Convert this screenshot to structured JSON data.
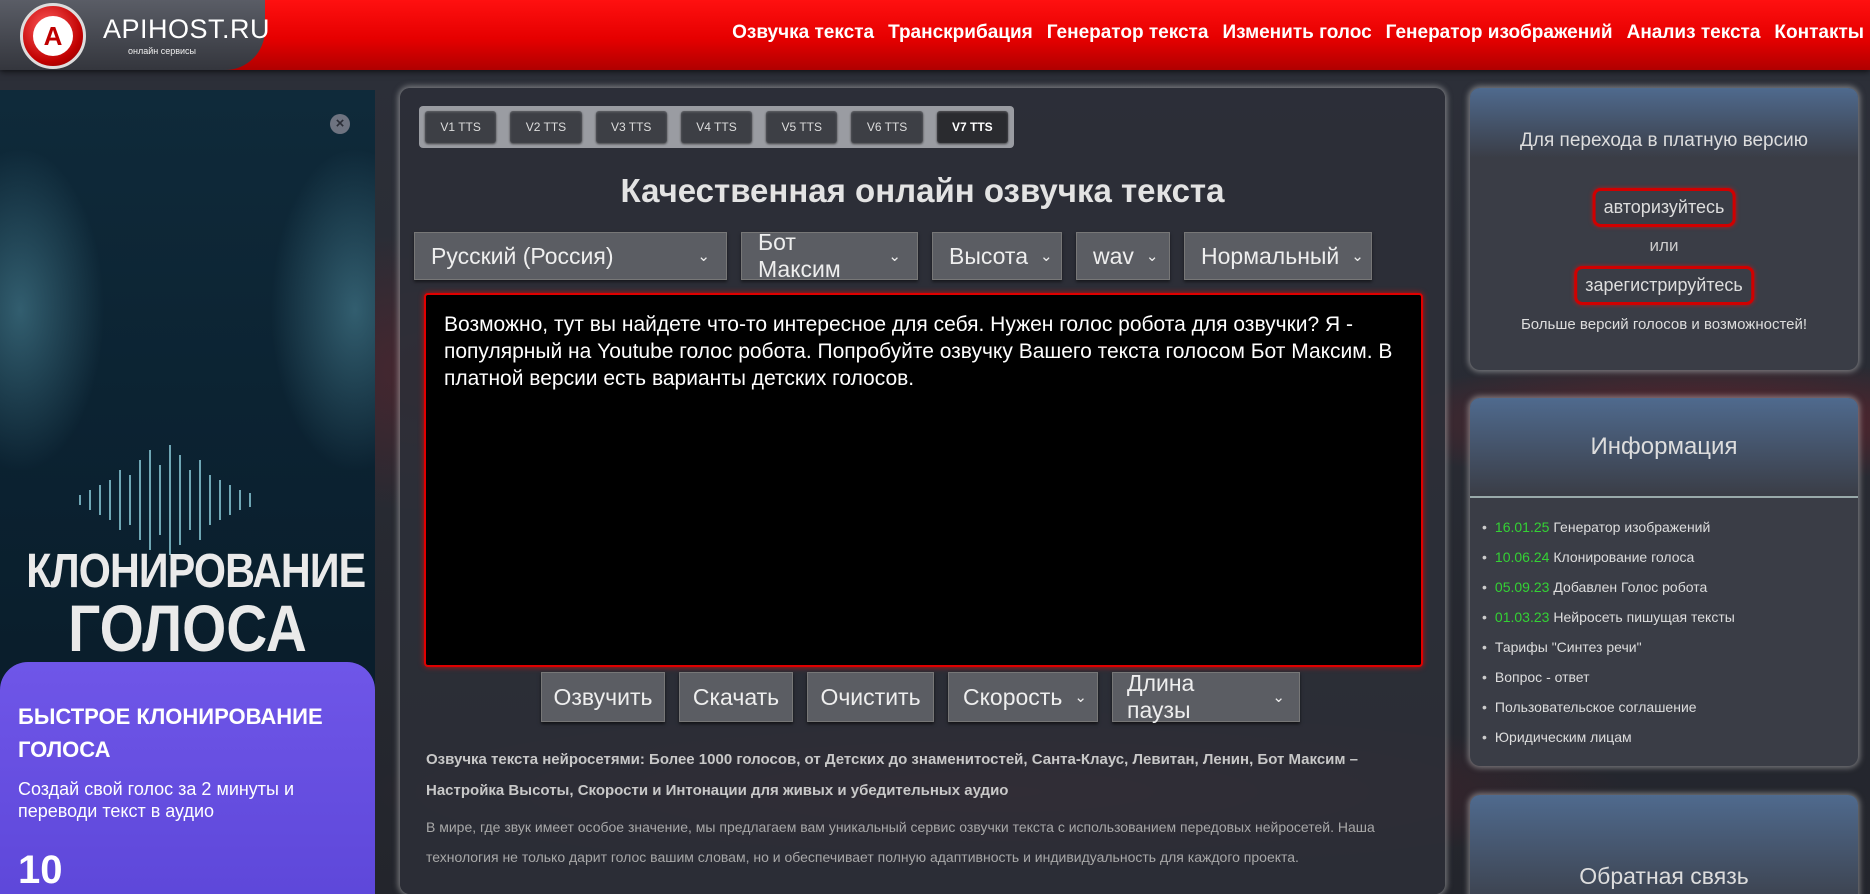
{
  "header": {
    "logo_text": "APIHOST.RU",
    "logo_sub": "онлайн сервисы",
    "nav": [
      "Озвучка текста",
      "Транскрибация",
      "Генератор текста",
      "Изменить голос",
      "Генератор изображений",
      "Анализ текста",
      "Контакты"
    ]
  },
  "ad": {
    "title_line1": "КЛОНИРОВАНИЕ",
    "title_line2": "ГОЛОСА",
    "card_title": "БЫСТРОЕ КЛОНИРОВАНИЕ ГОЛОСА",
    "card_text": "Создай свой голос за 2 минуты и переводи текст в аудио",
    "card_number": "10"
  },
  "tabs": [
    "V1 TTS",
    "V2 TTS",
    "V3 TTS",
    "V4 TTS",
    "V5 TTS",
    "V6 TTS",
    "V7 TTS"
  ],
  "active_tab": "V7 TTS",
  "main": {
    "title": "Качественная онлайн озвучка текста",
    "selects": {
      "language": "Русский (Россия)",
      "voice": "Бот Максим",
      "pitch": "Высота",
      "format": "wav",
      "mode": "Нормальный"
    },
    "text": "Возможно, тут вы найдете что-то интересное для себя. Нужен голос робота для озвучки? Я - популярный на Youtube голос робота. Попробуйте озвучку Вашего текста голосом Бот Максим. В платной версии есть варианты детских голосов.",
    "actions": {
      "speak": "Озвучить",
      "download": "Скачать",
      "clear": "Очистить",
      "speed": "Скорость",
      "pause": "Длина паузы"
    },
    "desc_bold": "Озвучка текста нейросетями: Более 1000 голосов, от Детских до знаменитостей, Санта-Клаус, Левитан, Ленин, Бот Максим – Настройка Высоты, Скорости и Интонации для живых и убедительных аудио",
    "desc": "В мире, где звук имеет особое значение, мы предлагаем вам уникальный сервис озвучки текста с использованием передовых нейросетей. Наша технология не только дарит голос вашим словам, но и обеспечивает полную адаптивность и индивидуальность для каждого проекта."
  },
  "paid": {
    "title": "Для перехода в платную версию",
    "login": "авторизуйтесь",
    "or": "или",
    "register": "зарегистрируйтесь",
    "more": "Больше версий голосов и возможностей!"
  },
  "info": {
    "title": "Информация",
    "items": [
      {
        "date": "16.01.25",
        "text": "Генератор изображений"
      },
      {
        "date": "10.06.24",
        "text": "Клонирование голоса"
      },
      {
        "date": "05.09.23",
        "text": "Добавлен Голос робота"
      },
      {
        "date": "01.03.23",
        "text": "Нейросеть пишущая тексты"
      },
      {
        "date": "",
        "text": "Тарифы \"Синтез речи\""
      },
      {
        "date": "",
        "text": "Вопрос - ответ"
      },
      {
        "date": "",
        "text": "Пользовательское соглашение"
      },
      {
        "date": "",
        "text": "Юридическим лицам"
      }
    ]
  },
  "feedback": {
    "title": "Обратная связь"
  }
}
